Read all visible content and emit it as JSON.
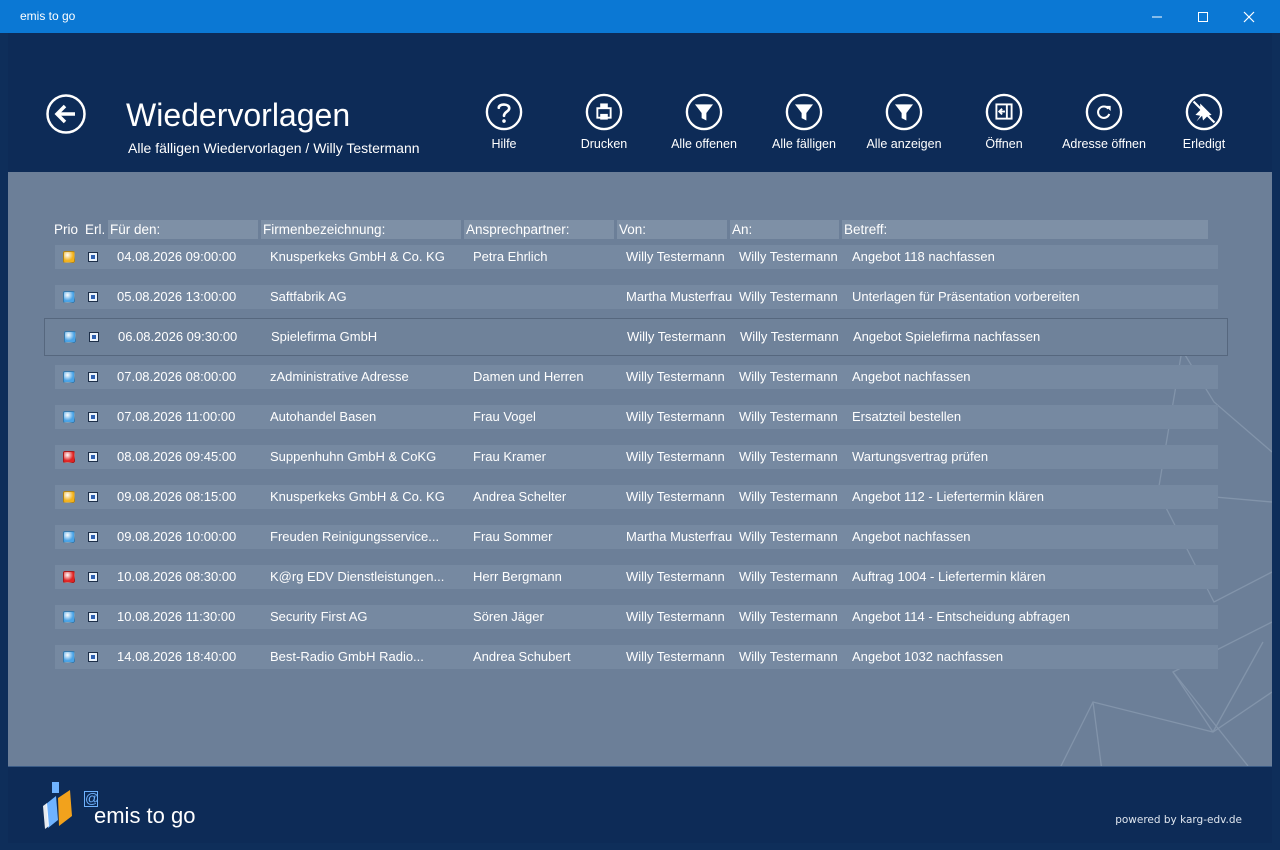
{
  "window": {
    "title": "emis to go"
  },
  "header": {
    "title": "Wiedervorlagen",
    "subtitle": "Alle fälligen Wiedervorlagen / Willy Testermann"
  },
  "toolbar": [
    {
      "label": "Hilfe",
      "icon": "help-icon"
    },
    {
      "label": "Drucken",
      "icon": "print-icon"
    },
    {
      "label": "Alle offenen",
      "icon": "filter-icon"
    },
    {
      "label": "Alle fälligen",
      "icon": "filter-icon"
    },
    {
      "label": "Alle anzeigen",
      "icon": "filter-icon"
    },
    {
      "label": "Öffnen",
      "icon": "open-icon"
    },
    {
      "label": "Adresse öffnen",
      "icon": "refresh-icon"
    },
    {
      "label": "Erledigt",
      "icon": "pin-off-icon"
    }
  ],
  "columns": [
    "Prio",
    "Erl.",
    "Für den:",
    "Firmenbezeichnung:",
    "Ansprechpartner:",
    "Von:",
    "An:",
    "Betreff:"
  ],
  "prio_colors": {
    "yellow": "#f2b21c",
    "blue": "#4aa3e6",
    "red": "#e02424"
  },
  "rows": [
    {
      "prio": "yellow",
      "date": "04.08.2026 09:00:00",
      "company": "Knusperkeks GmbH & Co. KG",
      "contact": "Petra Ehrlich",
      "from": "Willy Testermann",
      "to": "Willy Testermann",
      "subject": "Angebot 118 nachfassen"
    },
    {
      "prio": "blue",
      "date": "05.08.2026 13:00:00",
      "company": "Saftfabrik AG",
      "contact": "",
      "from": "Martha Musterfrau",
      "to": "Willy Testermann",
      "subject": "Unterlagen für Präsentation vorbereiten"
    },
    {
      "prio": "blue",
      "date": "06.08.2026 09:30:00",
      "company": "Spielefirma GmbH",
      "contact": "",
      "from": "Willy Testermann",
      "to": "Willy Testermann",
      "subject": "Angebot Spielefirma nachfassen",
      "selected": true
    },
    {
      "prio": "blue",
      "date": "07.08.2026 08:00:00",
      "company": "zAdministrative Adresse",
      "contact": "Damen und Herren",
      "from": "Willy Testermann",
      "to": "Willy Testermann",
      "subject": "Angebot nachfassen"
    },
    {
      "prio": "blue",
      "date": "07.08.2026 11:00:00",
      "company": "Autohandel Basen",
      "contact": "Frau Vogel",
      "from": "Willy Testermann",
      "to": "Willy Testermann",
      "subject": "Ersatzteil bestellen"
    },
    {
      "prio": "red",
      "date": "08.08.2026 09:45:00",
      "company": "Suppenhuhn GmbH & CoKG",
      "contact": "Frau Kramer",
      "from": "Willy Testermann",
      "to": "Willy Testermann",
      "subject": "Wartungsvertrag prüfen"
    },
    {
      "prio": "yellow",
      "date": "09.08.2026 08:15:00",
      "company": "Knusperkeks GmbH & Co. KG",
      "contact": "Andrea Schelter",
      "from": "Willy Testermann",
      "to": "Willy Testermann",
      "subject": "Angebot 112 - Liefertermin klären"
    },
    {
      "prio": "blue",
      "date": "09.08.2026 10:00:00",
      "company": "Freuden Reinigungsservice...",
      "contact": "Frau Sommer",
      "from": "Martha Musterfrau",
      "to": "Willy Testermann",
      "subject": "Angebot nachfassen"
    },
    {
      "prio": "red",
      "date": "10.08.2026 08:30:00",
      "company": "K@rg EDV Dienstleistungen...",
      "contact": "Herr Bergmann",
      "from": "Willy Testermann",
      "to": "Willy Testermann",
      "subject": "Auftrag 1004 - Liefertermin klären"
    },
    {
      "prio": "blue",
      "date": "10.08.2026 11:30:00",
      "company": "Security First AG",
      "contact": "Sören Jäger",
      "from": "Willy Testermann",
      "to": "Willy Testermann",
      "subject": "Angebot 114 - Entscheidung abfragen"
    },
    {
      "prio": "blue",
      "date": "14.08.2026 18:40:00",
      "company": "Best-Radio GmbH Radio...",
      "contact": "Andrea Schubert",
      "from": "Willy Testermann",
      "to": "Willy Testermann",
      "subject": "Angebot 1032 nachfassen"
    }
  ],
  "footer": {
    "logo_text": "emis to go",
    "logo_at": "@",
    "powered": "powered by karg-edv.de"
  }
}
